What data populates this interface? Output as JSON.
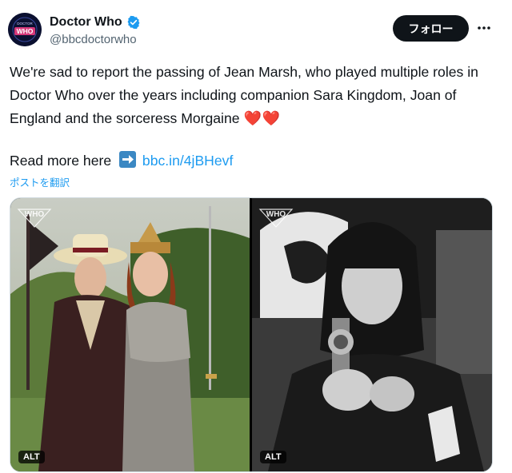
{
  "account": {
    "display_name": "Doctor Who",
    "handle": "@bbcdoctorwho",
    "avatar_label": "WHO",
    "avatar_sublabel": "DOCTOR"
  },
  "actions": {
    "follow_label": "フォロー",
    "more_icon": "more-horizontal-icon"
  },
  "tweet": {
    "text": "We're sad to report the passing of Jean Marsh, who played multiple roles in Doctor Who over the years including companion Sara Kingdom, Joan of England and the sorceress Morgaine",
    "hearts": "❤️❤️",
    "read_more_label": "Read more here",
    "link_text": "bbc.in/4jBHevf",
    "translate_label": "ポストを翻訳"
  },
  "media": {
    "photos": [
      {
        "alt_label": "ALT",
        "watermark": "WHO",
        "style": "color"
      },
      {
        "alt_label": "ALT",
        "watermark": "WHO",
        "style": "grayscale"
      }
    ]
  },
  "colors": {
    "link": "#1d9bf0",
    "text": "#0f1419",
    "secondary": "#536471",
    "follow_bg": "#0f1419",
    "verified": "#1d9bf0",
    "heart": "#e0245e"
  }
}
